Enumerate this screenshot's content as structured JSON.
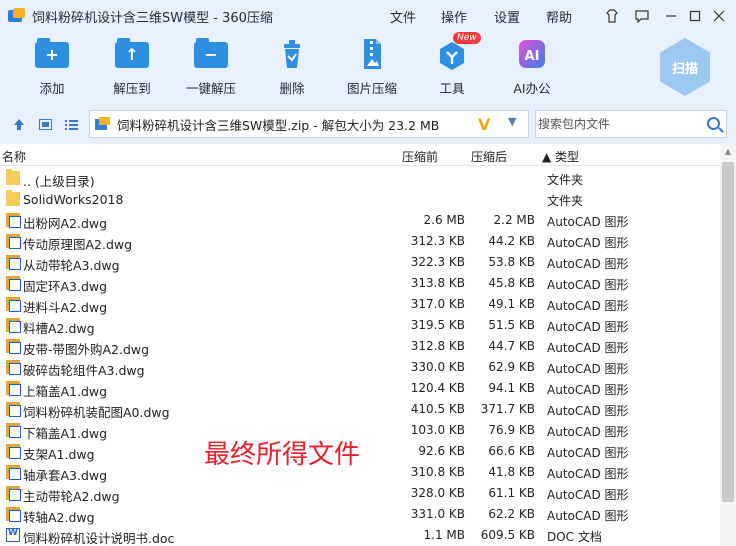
{
  "window": {
    "title": "饲料粉碎机设计含三维SW模型 - 360压缩",
    "menu": [
      "文件",
      "操作",
      "设置",
      "帮助"
    ]
  },
  "toolbar": {
    "tools": [
      {
        "label": "添加",
        "icon": "add-icon"
      },
      {
        "label": "解压到",
        "icon": "extract-to-icon"
      },
      {
        "label": "一键解压",
        "icon": "one-click-extract-icon"
      },
      {
        "label": "删除",
        "icon": "delete-icon"
      },
      {
        "label": "图片压缩",
        "icon": "image-compress-icon"
      },
      {
        "label": "工具",
        "icon": "tools-icon",
        "badge": "New"
      },
      {
        "label": "AI办公",
        "icon": "ai-office-icon"
      }
    ],
    "scan_label": "扫描"
  },
  "address": {
    "path": "饲料粉碎机设计含三维SW模型.zip - 解包大小为 23.2 MB",
    "search_placeholder": "搜索包内文件"
  },
  "columns": {
    "name": "名称",
    "compressed": "压缩前",
    "original": "压缩后",
    "type": "▲ 类型"
  },
  "files": [
    {
      "name": ".. (上级目录)",
      "compressed": "",
      "original": "",
      "type": "文件夹",
      "kind": "folder"
    },
    {
      "name": "SolidWorks2018",
      "compressed": "",
      "original": "",
      "type": "文件夹",
      "kind": "folder"
    },
    {
      "name": "出粉网A2.dwg",
      "compressed": "2.6 MB",
      "original": "2.2 MB",
      "type": "AutoCAD 图形",
      "kind": "dwg"
    },
    {
      "name": "传动原理图A2.dwg",
      "compressed": "312.3 KB",
      "original": "44.2 KB",
      "type": "AutoCAD 图形",
      "kind": "dwg"
    },
    {
      "name": "从动带轮A3.dwg",
      "compressed": "322.3 KB",
      "original": "53.8 KB",
      "type": "AutoCAD 图形",
      "kind": "dwg"
    },
    {
      "name": "固定环A3.dwg",
      "compressed": "313.8 KB",
      "original": "45.8 KB",
      "type": "AutoCAD 图形",
      "kind": "dwg"
    },
    {
      "name": "进料斗A2.dwg",
      "compressed": "317.0 KB",
      "original": "49.1 KB",
      "type": "AutoCAD 图形",
      "kind": "dwg"
    },
    {
      "name": "料槽A2.dwg",
      "compressed": "319.5 KB",
      "original": "51.5 KB",
      "type": "AutoCAD 图形",
      "kind": "dwg"
    },
    {
      "name": "皮带-带图外购A2.dwg",
      "compressed": "312.8 KB",
      "original": "44.7 KB",
      "type": "AutoCAD 图形",
      "kind": "dwg"
    },
    {
      "name": "破碎齿轮组件A3.dwg",
      "compressed": "330.0 KB",
      "original": "62.9 KB",
      "type": "AutoCAD 图形",
      "kind": "dwg"
    },
    {
      "name": "上箱盖A1.dwg",
      "compressed": "120.4 KB",
      "original": "94.1 KB",
      "type": "AutoCAD 图形",
      "kind": "dwg"
    },
    {
      "name": "饲料粉碎机装配图A0.dwg",
      "compressed": "410.5 KB",
      "original": "371.7 KB",
      "type": "AutoCAD 图形",
      "kind": "dwg"
    },
    {
      "name": "下箱盖A1.dwg",
      "compressed": "103.0 KB",
      "original": "76.9 KB",
      "type": "AutoCAD 图形",
      "kind": "dwg"
    },
    {
      "name": "支架A1.dwg",
      "compressed": "92.6 KB",
      "original": "66.6 KB",
      "type": "AutoCAD 图形",
      "kind": "dwg"
    },
    {
      "name": "轴承套A3.dwg",
      "compressed": "310.8 KB",
      "original": "41.8 KB",
      "type": "AutoCAD 图形",
      "kind": "dwg"
    },
    {
      "name": "主动带轮A2.dwg",
      "compressed": "328.0 KB",
      "original": "61.1 KB",
      "type": "AutoCAD 图形",
      "kind": "dwg"
    },
    {
      "name": "转轴A2.dwg",
      "compressed": "331.0 KB",
      "original": "62.2 KB",
      "type": "AutoCAD 图形",
      "kind": "dwg"
    },
    {
      "name": "饲料粉碎机设计说明书.doc",
      "compressed": "1.1 MB",
      "original": "609.5 KB",
      "type": "DOC 文档",
      "kind": "doc"
    }
  ],
  "watermark": "最终所得文件"
}
